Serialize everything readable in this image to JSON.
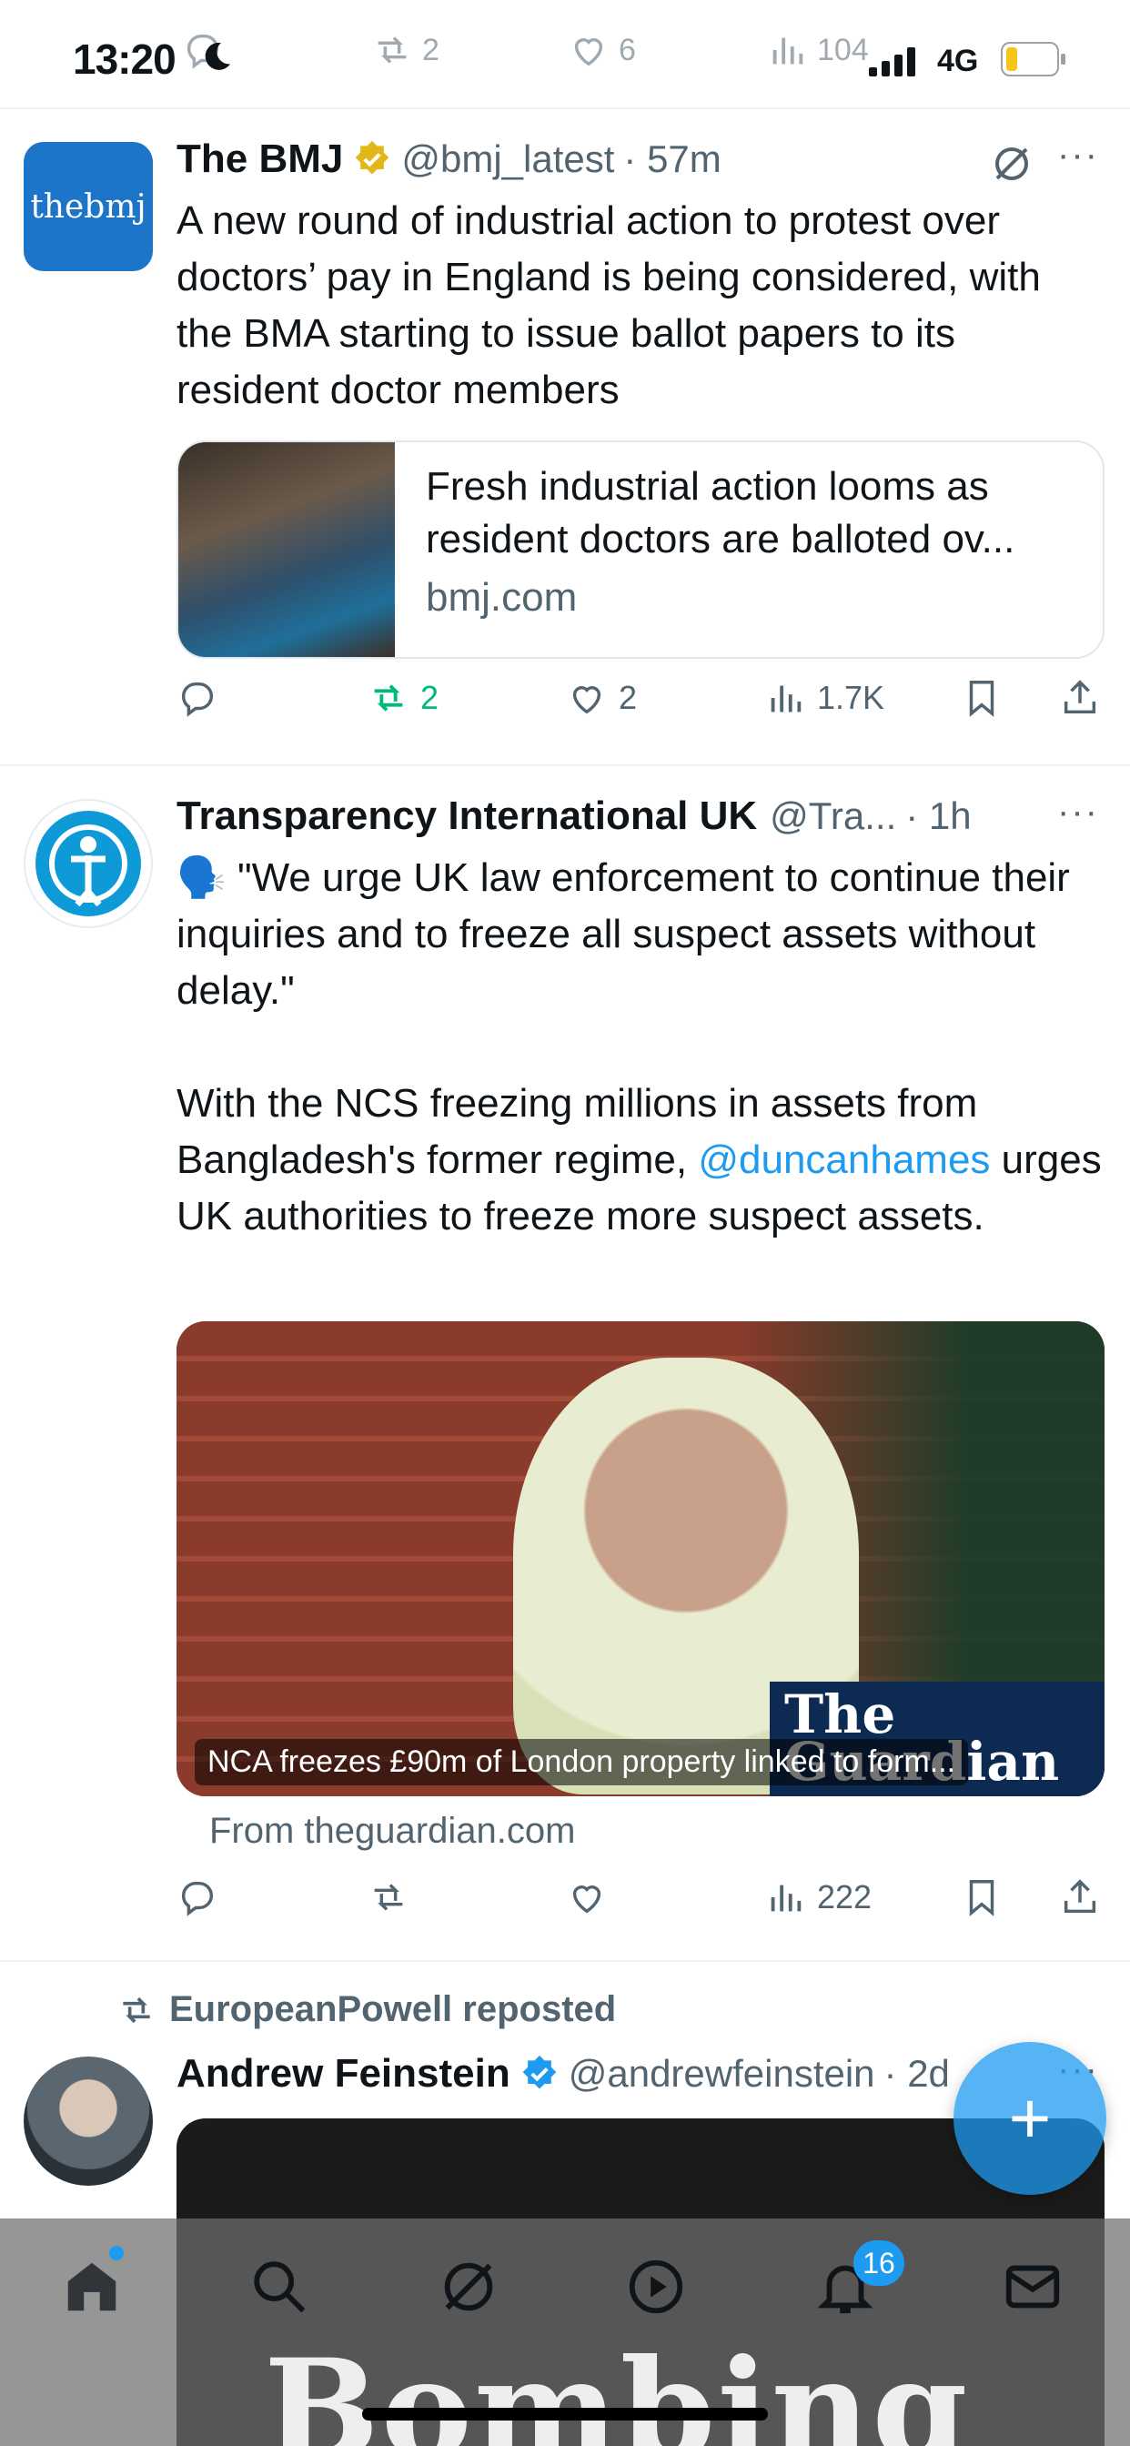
{
  "status_bar": {
    "time": "13:20",
    "network": "4G"
  },
  "ghost_actions": {
    "reposts": "2",
    "likes": "6",
    "views": "104"
  },
  "tweets": [
    {
      "name": "The BMJ",
      "handle": "@bmj_latest",
      "time": "· 57m",
      "avatar_text": "thebmj",
      "text": "A new round of industrial action to protest over doctors’ pay in England is being considered, with the BMA starting to issue ballot papers to its resident doctor members",
      "card": {
        "title": "Fresh industrial action looms as resident doctors are balloted ov...",
        "domain": "bmj.com"
      },
      "actions": {
        "replies": "",
        "reposts": "2",
        "likes": "2",
        "views": "1.7K"
      }
    },
    {
      "name": "Transparency International UK",
      "handle": "@Tra...",
      "time": "· 1h",
      "text_part1": "🗣️ \"We urge UK law enforcement to continue their inquiries and to freeze all suspect assets without delay.\"",
      "text_part2_a": "With the NCS freezing millions in assets from Bangladesh's former regime, ",
      "mention": "@duncanhames",
      "text_part2_b": " urges UK authorities to freeze more suspect assets.",
      "media": {
        "caption": "NCA freezes £90m of London property linked to form...",
        "logo": "The Guardian"
      },
      "from": "From theguardian.com",
      "actions": {
        "replies": "",
        "reposts": "",
        "likes": "",
        "views": "222"
      }
    },
    {
      "repost_by": "EuropeanPowell reposted",
      "name": "Andrew Feinstein",
      "handle": "@andrewfeinstein",
      "time": "· 2d"
    }
  ],
  "bottom_nav": {
    "notifications_badge": "16",
    "behind_text": "Bombing"
  },
  "colors": {
    "accent": "#1d9bf0",
    "repost_green": "#00ba7c",
    "muted": "#536471",
    "verified_gold": "#e2b719"
  }
}
